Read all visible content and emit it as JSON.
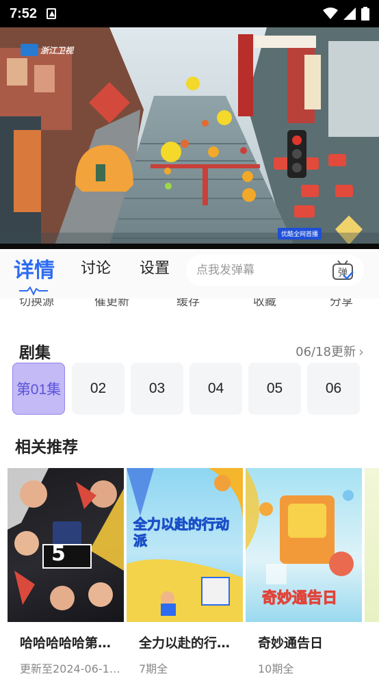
{
  "status_bar": {
    "time": "7:52"
  },
  "video": {
    "channel_watermark": "浙江卫视",
    "badge": "优酷全网首播"
  },
  "tabs": [
    {
      "label": "详情"
    },
    {
      "label": "讨论"
    },
    {
      "label": "设置"
    }
  ],
  "danmaku": {
    "placeholder": "点我发弹幕",
    "button_glyph": "弹"
  },
  "actions": [
    "切换源",
    "催更新",
    "缓存",
    "收藏",
    "分享"
  ],
  "episodes": {
    "title": "剧集",
    "update_text": "06/18更新",
    "items": [
      "第01集",
      "02",
      "03",
      "04",
      "05",
      "06"
    ],
    "selected_index": 0
  },
  "recommend": {
    "title": "相关推荐",
    "items": [
      {
        "title": "哈哈哈哈哈第…",
        "subtitle": "更新至2024-06-1…",
        "poster_text": "5"
      },
      {
        "title": "全力以赴的行…",
        "subtitle": "7期全",
        "poster_text": "全力以赴的行动派"
      },
      {
        "title": "奇妙通告日",
        "subtitle": "10期全",
        "poster_text": "奇妙通告日"
      }
    ]
  },
  "colors": {
    "accent": "#2d6bf0",
    "episode_selected_bg": "#c3baf6",
    "episode_selected_text": "#5b53d9"
  }
}
